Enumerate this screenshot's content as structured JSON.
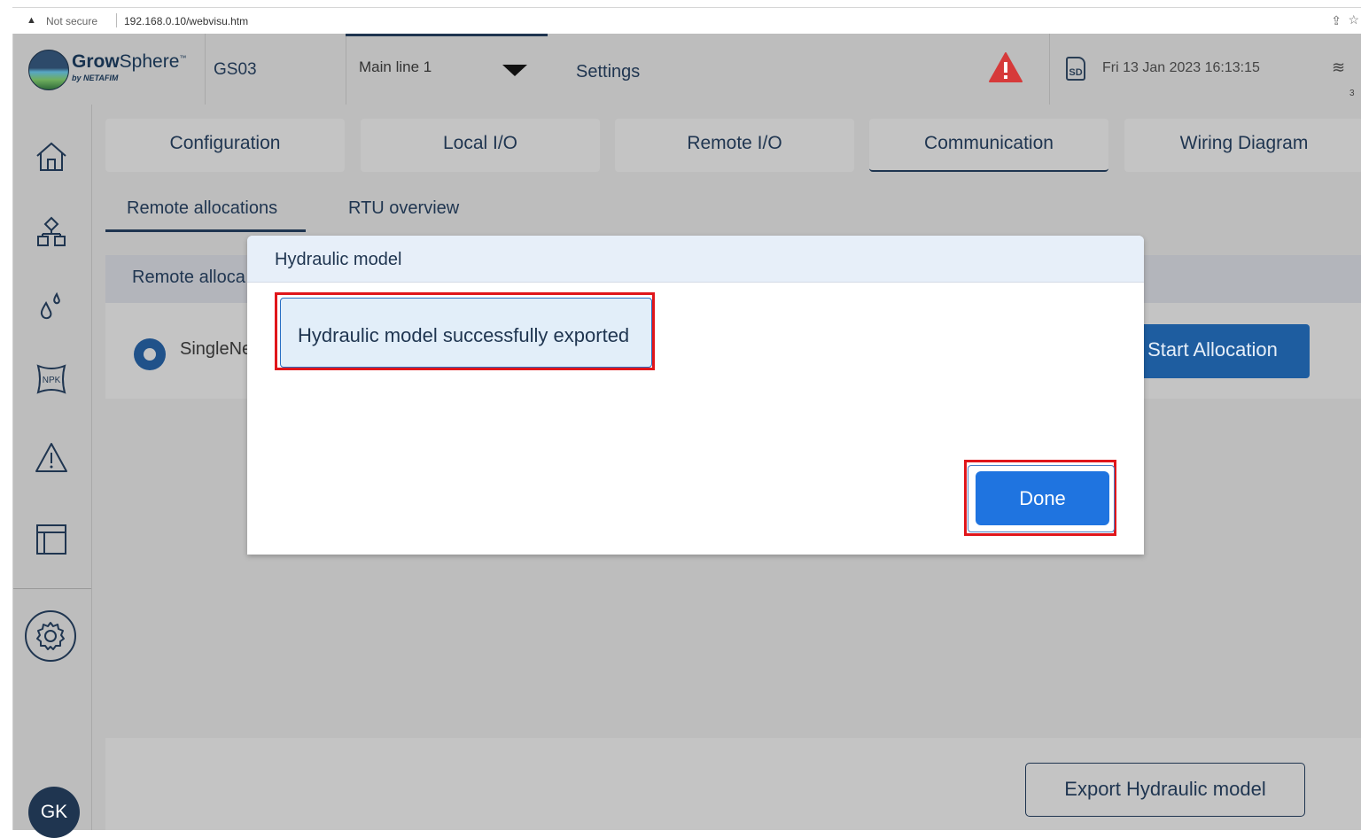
{
  "browser": {
    "security_label": "Not secure",
    "url": "192.168.0.10/webvisu.htm"
  },
  "header": {
    "brand_main": "Grow",
    "brand_rest": "Sphere",
    "brand_tm": "™",
    "brand_sub": "by NETAFIM",
    "controller": "GS03",
    "mainline_select": "Main line 1",
    "page_title": "Settings",
    "sd_label": "SD",
    "datetime": "Fri 13 Jan 2023   16:13:15",
    "wifi_value": "3"
  },
  "tabs": [
    {
      "label": "Configuration",
      "active": false
    },
    {
      "label": "Local I/O",
      "active": false
    },
    {
      "label": "Remote  I/O",
      "active": false
    },
    {
      "label": "Communication",
      "active": true
    },
    {
      "label": "Wiring Diagram",
      "active": false
    }
  ],
  "subtabs": [
    {
      "label": "Remote allocations",
      "active": true
    },
    {
      "label": "RTU overview",
      "active": false
    }
  ],
  "panel": {
    "header_label": "Remote alloca",
    "radio_label": "SingleNe",
    "start_button": "Start Allocation"
  },
  "footer": {
    "export_button": "Export Hydraulic model"
  },
  "sidebar": {
    "avatar_initials": "GK",
    "icons": [
      "home-icon",
      "network-icon",
      "water-drops-icon",
      "fertilizer-npk-icon",
      "warning-icon",
      "layout-grid-icon",
      "settings-gear-icon"
    ],
    "npk_label": "NPK"
  },
  "modal": {
    "title": "Hydraulic model",
    "message": "Hydraulic model successfully exported",
    "done_button": "Done"
  },
  "colors": {
    "navy": "#1f3550",
    "alert_red": "#d63a3a",
    "done_blue": "#1f74e0",
    "highlight_red": "#e0161b"
  }
}
